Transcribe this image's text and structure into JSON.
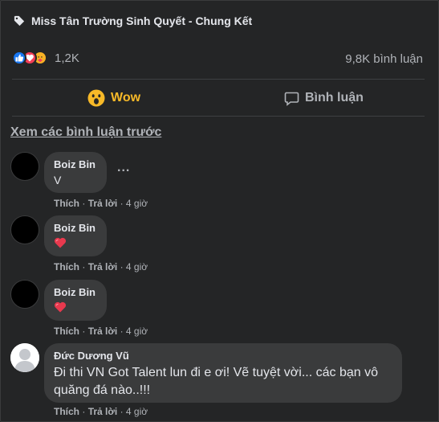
{
  "post": {
    "tagline": "Miss Tân Trường Sinh Quyết - Chung Kết",
    "reaction_count": "1,2K",
    "comment_count": "9,8K bình luận",
    "reaction_icons": [
      "like-icon",
      "love-icon",
      "care-icon"
    ]
  },
  "actions": {
    "wow_label": "Wow",
    "comment_label": "Bình luận"
  },
  "view_previous": "Xem các bình luận trước",
  "comments": [
    {
      "author": "Boiz Bin",
      "text": "V",
      "like": "Thích",
      "reply": "Trả lời",
      "time": "4 giờ"
    },
    {
      "author": "Boiz Bin",
      "text": "",
      "emoji": "heart",
      "like": "Thích",
      "reply": "Trả lời",
      "time": "4 giờ"
    },
    {
      "author": "Boiz Bin",
      "text": "",
      "emoji": "heart",
      "like": "Thích",
      "reply": "Trả lời",
      "time": "4 giờ"
    },
    {
      "author": "Đức Dương Vũ",
      "text": "Đi thi VN Got Talent lun đi e ơi! Vẽ tuyệt vời... các bạn vô quăng đá nào..!!!",
      "like": "Thích",
      "reply": "Trả lời",
      "time": "4 giờ"
    }
  ],
  "more_options": "...",
  "separator": "·",
  "colors": {
    "background": "#242526",
    "bubble": "#3a3b3c",
    "wow_accent": "#f7b928",
    "like_blue": "#1877f2",
    "love_red": "#f33e58"
  }
}
